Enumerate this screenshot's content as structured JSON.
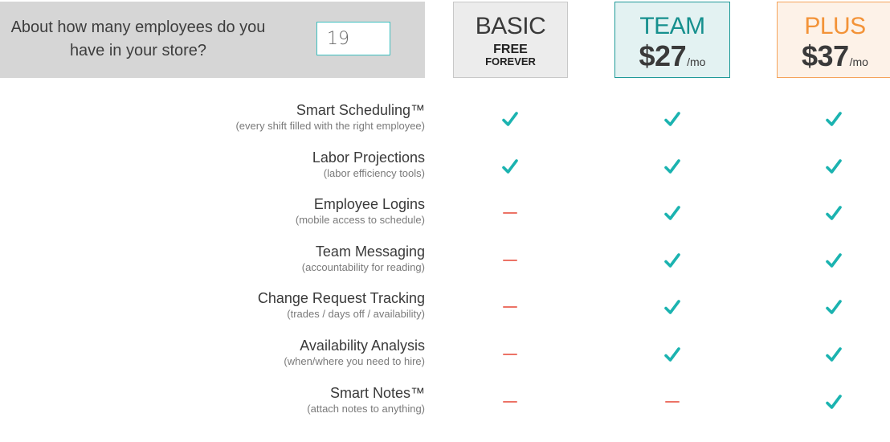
{
  "question": {
    "text": "About how many employees do you have in your store?",
    "employee_count": "19"
  },
  "plans": [
    {
      "id": "basic",
      "name": "BASIC",
      "free_line1": "FREE",
      "free_line2": "FOREVER",
      "price": null,
      "per": null,
      "color": "#3a3a3a"
    },
    {
      "id": "team",
      "name": "TEAM",
      "price": "$27",
      "per": "/mo",
      "color": "#16908e"
    },
    {
      "id": "plus",
      "name": "PLUS",
      "price": "$37",
      "per": "/mo",
      "color": "#f39338"
    }
  ],
  "colors": {
    "check": "#1bb3b0",
    "dash": "#ec7366"
  },
  "features": [
    {
      "name": "Smart Scheduling™",
      "desc": "(every shift filled with the right employee)",
      "basic": true,
      "team": true,
      "plus": true
    },
    {
      "name": "Labor Projections",
      "desc": "(labor efficiency tools)",
      "basic": true,
      "team": true,
      "plus": true
    },
    {
      "name": "Employee Logins",
      "desc": "(mobile access to schedule)",
      "basic": false,
      "team": true,
      "plus": true
    },
    {
      "name": "Team Messaging",
      "desc": "(accountability for reading)",
      "basic": false,
      "team": true,
      "plus": true
    },
    {
      "name": "Change Request Tracking",
      "desc": "(trades / days off / availability)",
      "basic": false,
      "team": true,
      "plus": true
    },
    {
      "name": "Availability Analysis",
      "desc": "(when/where you need to hire)",
      "basic": false,
      "team": true,
      "plus": true
    },
    {
      "name": "Smart Notes™",
      "desc": "(attach notes to anything)",
      "basic": false,
      "team": false,
      "plus": true
    }
  ]
}
